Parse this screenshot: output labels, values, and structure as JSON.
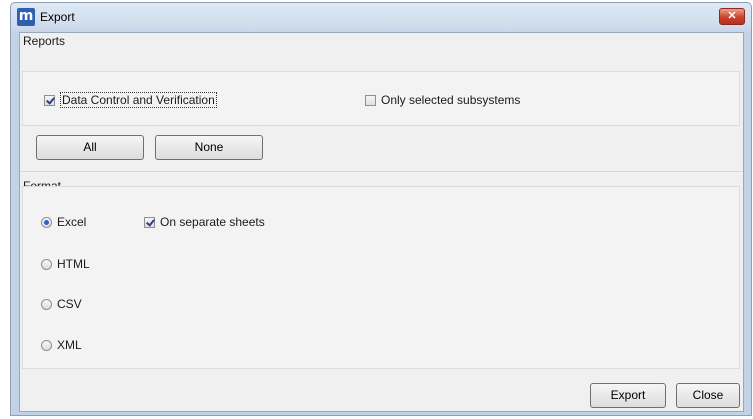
{
  "window": {
    "title": "Export",
    "logo_text": "m",
    "close_glyph": "✕"
  },
  "reports": {
    "group_title": "Reports",
    "checkboxes": [
      {
        "label": "Data Control and Verification",
        "checked": true
      },
      {
        "label": "Only selected subsystems",
        "checked": false
      }
    ],
    "all_label": "All",
    "none_label": "None"
  },
  "format": {
    "group_title": "Format",
    "options": [
      {
        "label": "Excel",
        "selected": true
      },
      {
        "label": "HTML",
        "selected": false
      },
      {
        "label": "CSV",
        "selected": false
      },
      {
        "label": "XML",
        "selected": false
      }
    ],
    "separate_sheets": {
      "label": "On separate sheets",
      "checked": true
    }
  },
  "footer": {
    "export_label": "Export",
    "close_label": "Close"
  },
  "colors": {
    "title_gradient_top": "#dfe9f5",
    "close_red": "#c9422d",
    "radio_accent": "#2a64c8",
    "check_mark": "#2a3f8f"
  }
}
